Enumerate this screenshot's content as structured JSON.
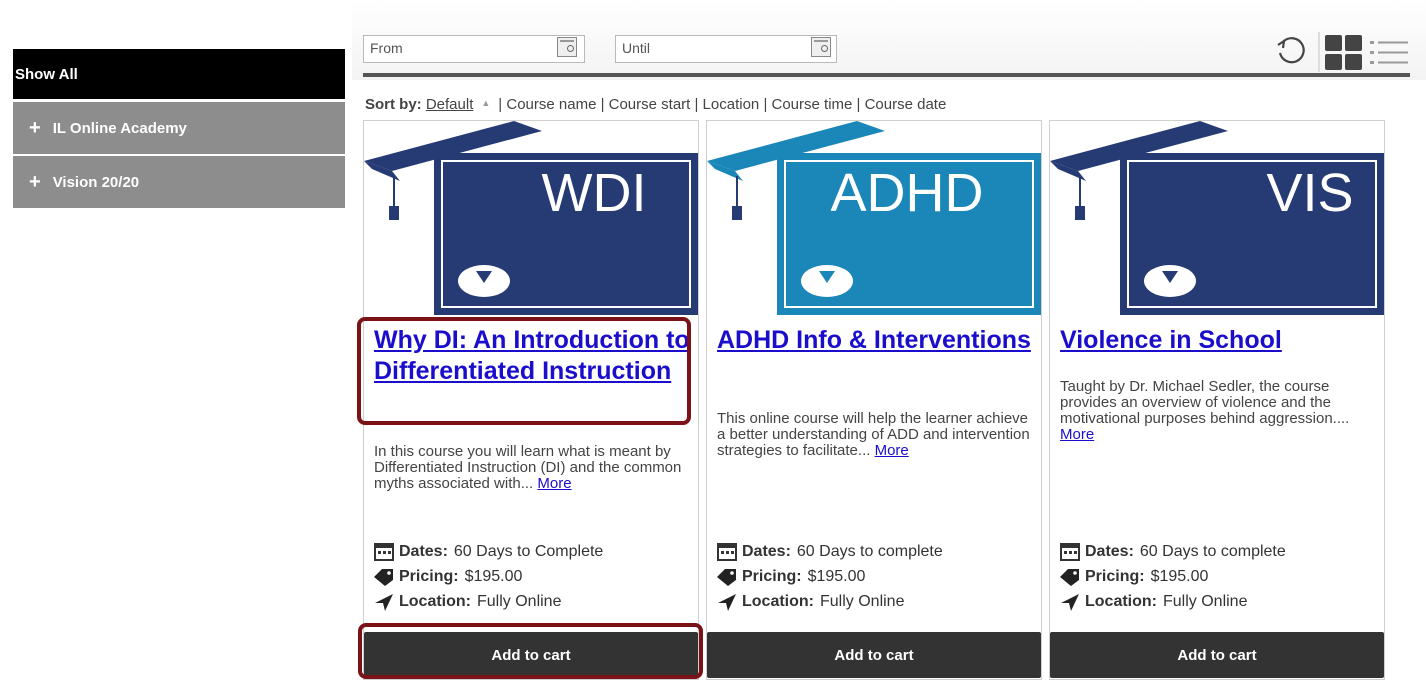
{
  "sidebar": {
    "items": [
      {
        "label": "Show All"
      },
      {
        "label": "IL Online Academy",
        "prefix": "+"
      },
      {
        "label": "Vision 20/20",
        "prefix": "+"
      }
    ]
  },
  "filters": {
    "from_placeholder": "From",
    "until_placeholder": "Until"
  },
  "sort": {
    "label": "Sort by:",
    "default": "Default",
    "options": "| Course name | Course start | Location | Course time | Course date"
  },
  "meta_labels": {
    "dates": "Dates:",
    "pricing": "Pricing:",
    "location": "Location:"
  },
  "courses": [
    {
      "badge": "WDI",
      "color": "#263a73",
      "title": "Why DI: An Introduction to Differentiated Instruction",
      "description": "In this course you will learn what is meant by Differentiated Instruction (DI) and the common myths associated with...",
      "more": "More",
      "dates": "60 Days to Complete",
      "pricing": "$195.00",
      "location": "Fully Online",
      "button": "Add to cart"
    },
    {
      "badge": "ADHD",
      "color": "#1b86b8",
      "title": "ADHD Info & Interventions",
      "description": "This online course will help the learner achieve a better understanding of ADD and intervention strategies to facilitate...",
      "more": "More",
      "dates": "60 Days to complete",
      "pricing": "$195.00",
      "location": "Fully Online",
      "button": "Add to cart"
    },
    {
      "badge": "VIS",
      "color": "#263a73",
      "title": "Violence in School",
      "description": "Taught by Dr. Michael Sedler, the course provides an overview of violence and the motivational purposes behind aggression....",
      "more": "More",
      "dates": "60 Days to complete",
      "pricing": "$195.00",
      "location": "Fully Online",
      "button": "Add to cart"
    }
  ]
}
